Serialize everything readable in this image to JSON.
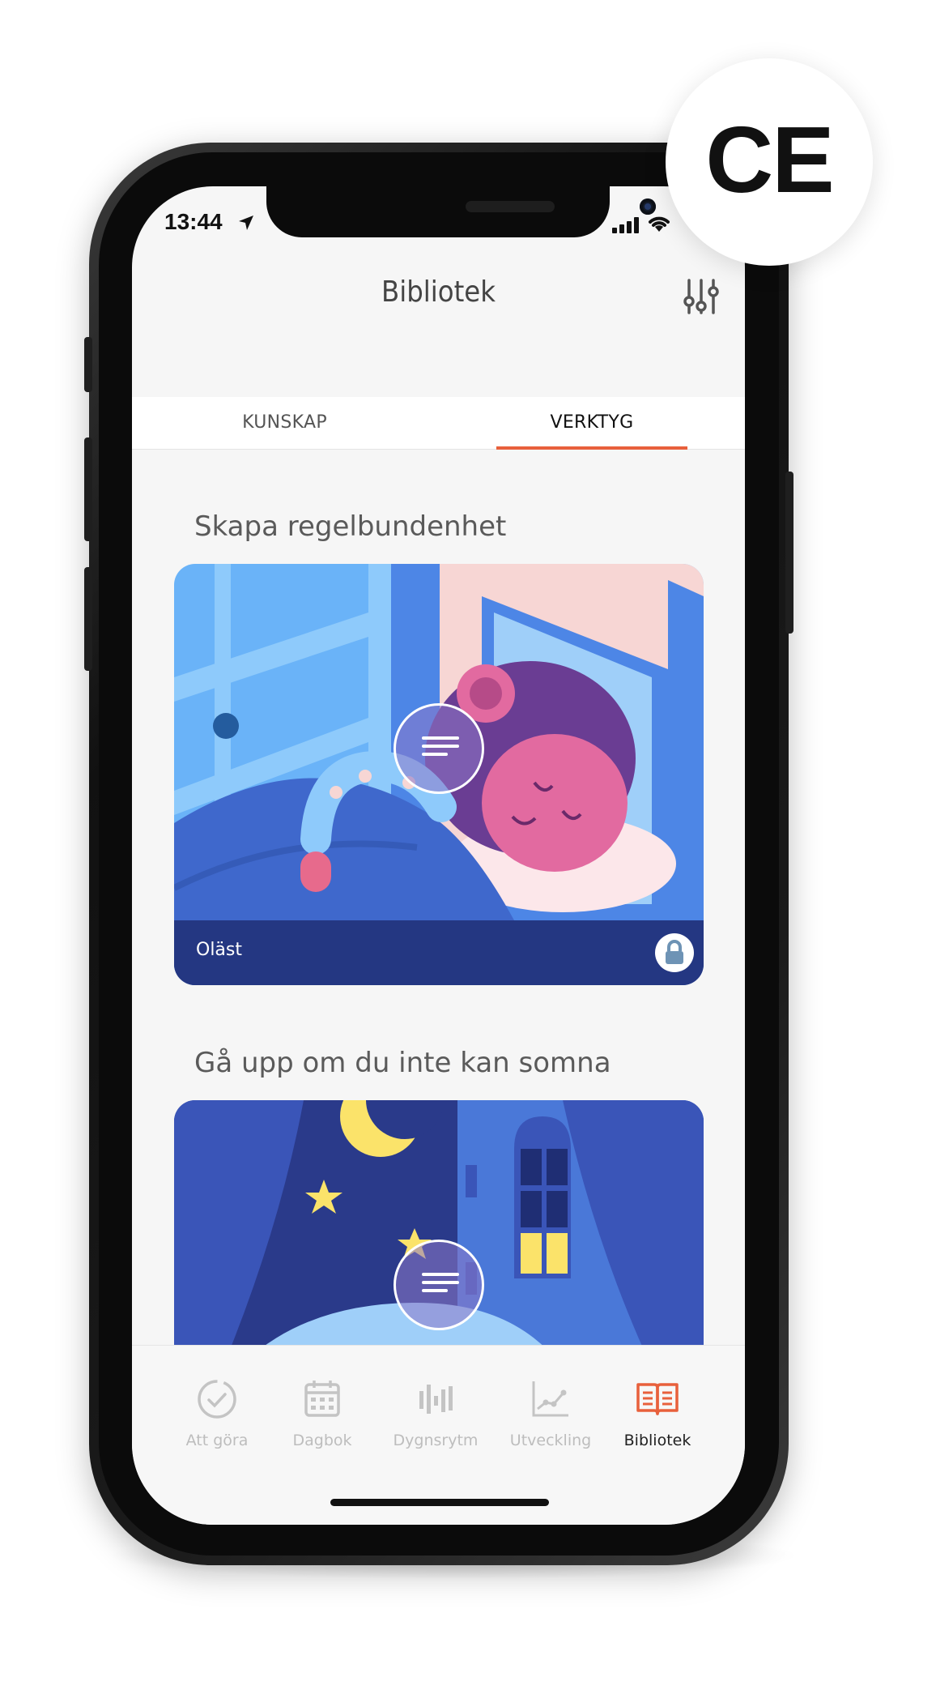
{
  "status_bar": {
    "time": "13:44"
  },
  "header": {
    "title": "Bibliotek"
  },
  "tabs": [
    {
      "label": "KUNSKAP",
      "active": false
    },
    {
      "label": "VERKTYG",
      "active": true
    }
  ],
  "sections": [
    {
      "title": "Skapa regelbundenhet",
      "card_status": "Oläst",
      "locked": true
    },
    {
      "title": "Gå upp om du inte kan somna"
    }
  ],
  "bottom_nav": [
    {
      "label": "Att göra",
      "icon": "check-circle-icon",
      "active": false
    },
    {
      "label": "Dagbok",
      "icon": "calendar-icon",
      "active": false
    },
    {
      "label": "Dygnsrytm",
      "icon": "bars-icon",
      "active": false
    },
    {
      "label": "Utveckling",
      "icon": "line-chart-icon",
      "active": false
    },
    {
      "label": "Bibliotek",
      "icon": "book-icon",
      "active": true
    }
  ],
  "certification": {
    "mark": "CE"
  },
  "colors": {
    "accent": "#e8603c",
    "inactive": "#bdbdbd"
  }
}
